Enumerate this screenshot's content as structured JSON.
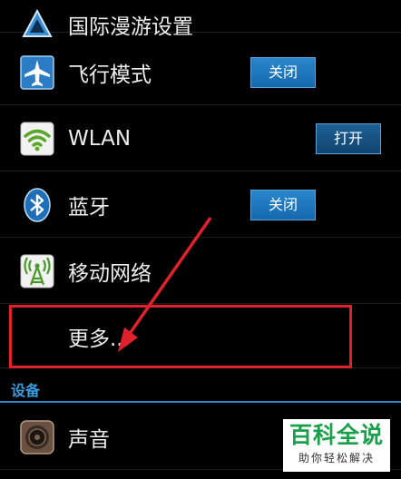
{
  "settings": {
    "items": [
      {
        "label": "国际漫游设置",
        "icon": "roaming-triangle-icon"
      },
      {
        "label": "飞行模式",
        "icon": "airplane-icon",
        "toggle": "关闭",
        "toggle_state": "off"
      },
      {
        "label": "WLAN",
        "icon": "wifi-icon",
        "toggle": "打开",
        "toggle_state": "on"
      },
      {
        "label": "蓝牙",
        "icon": "bluetooth-icon",
        "toggle": "关闭",
        "toggle_state": "off"
      },
      {
        "label": "移动网络",
        "icon": "mobile-network-icon"
      },
      {
        "label": "更多..."
      },
      {
        "label": "声音",
        "icon": "speaker-icon"
      }
    ],
    "section_header": "设备"
  },
  "annotation": {
    "highlight_color": "#e0212b",
    "arrow_color": "#e0212b"
  },
  "watermark": {
    "main": "百科全说",
    "sub": "助你轻松解决"
  },
  "colors": {
    "accent": "#2f86c8",
    "toggle_off": "#2a86cc",
    "toggle_on": "#1f5f94"
  }
}
